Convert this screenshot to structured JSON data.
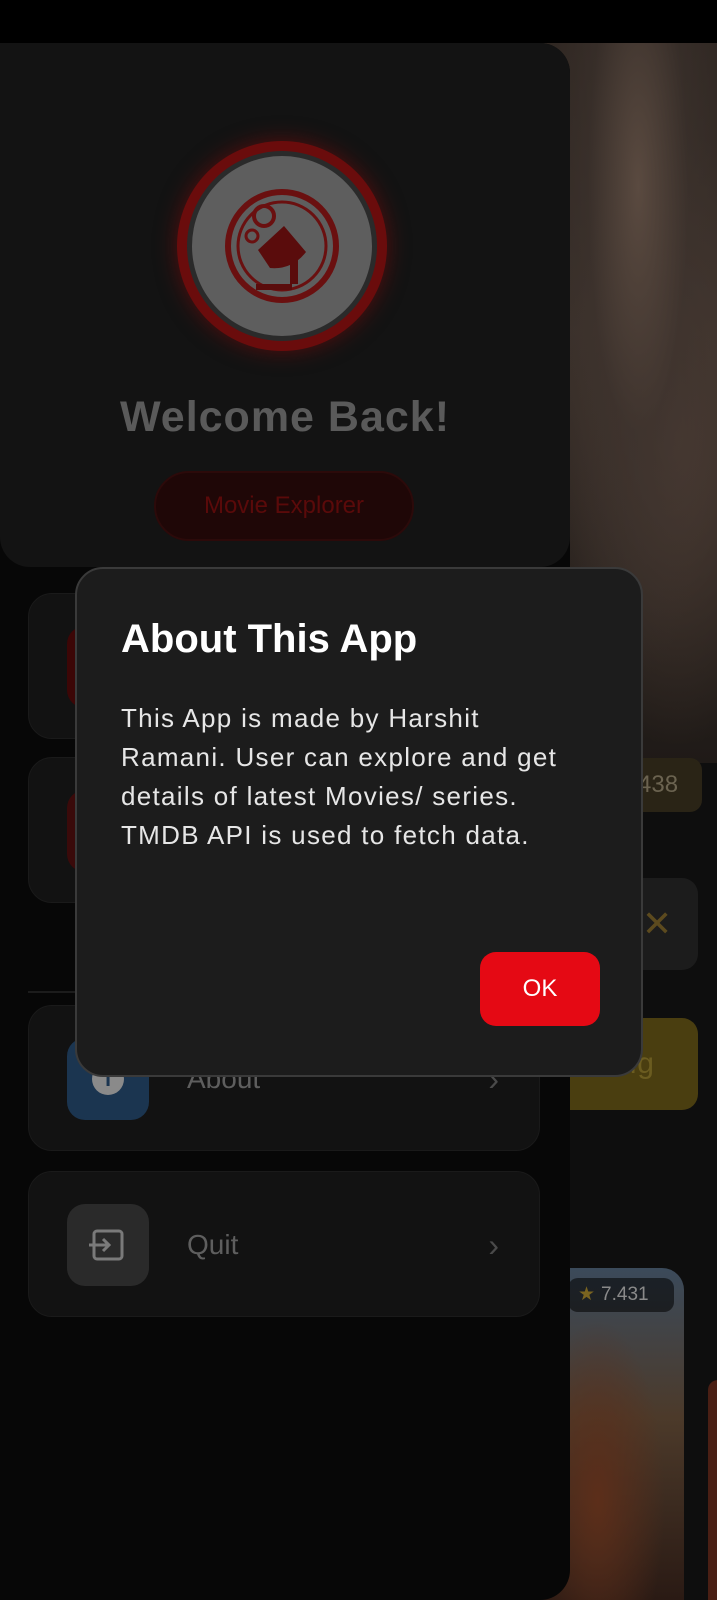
{
  "drawer": {
    "welcome": "Welcome Back!",
    "app_name": "Movie Explorer",
    "menu": [
      {
        "label": "About",
        "icon": "info-icon"
      },
      {
        "label": "Quit",
        "icon": "exit-icon"
      }
    ]
  },
  "dialog": {
    "title": "About This App",
    "body": "This App is made by Harshit Ramani. User can explore and get details of latest Movies/ series. TMDB API is used to fetch data.",
    "ok_label": "OK"
  },
  "background": {
    "rating_partial": "438",
    "yellow_button_partial": "ıg",
    "poster_rating": "7.431"
  },
  "colors": {
    "accent": "#e50914",
    "dialog_bg": "#1c1c1c"
  }
}
